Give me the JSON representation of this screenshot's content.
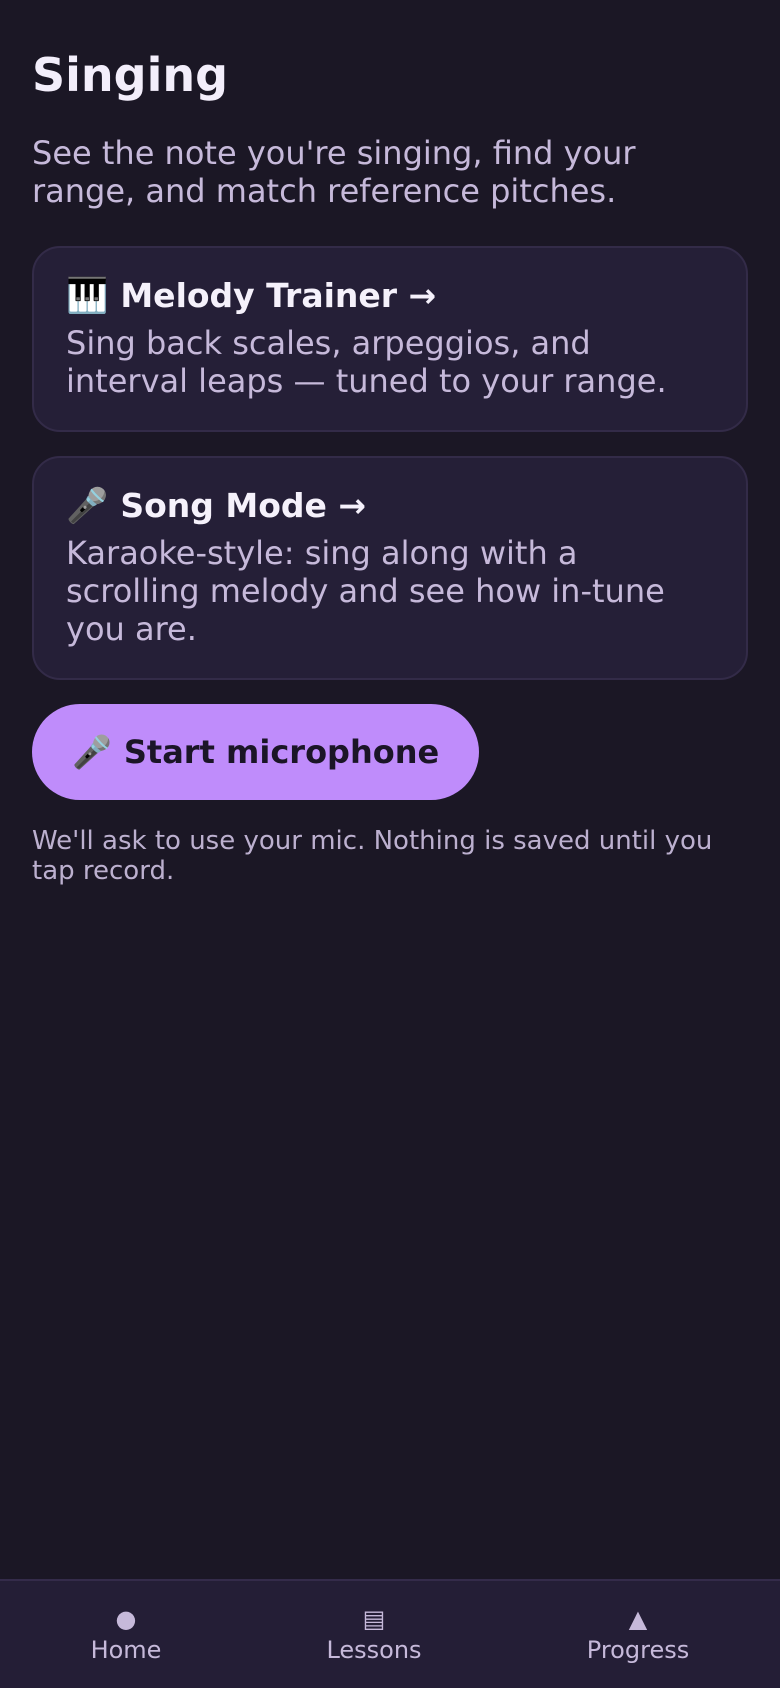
{
  "header": {
    "title": "Singing",
    "subtitle": "See the note you're singing, find your range, and match reference pitches."
  },
  "cards": [
    {
      "icon": "piano-keys-icon",
      "emoji": "🎹",
      "title": "Melody Trainer →",
      "description": "Sing back scales, arpeggios, and interval leaps — tuned to your range."
    },
    {
      "icon": "microphone-icon",
      "emoji": "🎤",
      "title": "Song Mode →",
      "description": "Karaoke-style: sing along with a scrolling melody and see how in-tune you are."
    }
  ],
  "mic": {
    "emoji": "🎤",
    "button_label": "Start microphone",
    "note": "We'll ask to use your mic. Nothing is saved until you tap record."
  },
  "nav": [
    {
      "icon": "circle-icon",
      "glyph": "●",
      "label": "Home"
    },
    {
      "icon": "list-icon",
      "glyph": "▤",
      "label": "Lessons"
    },
    {
      "icon": "triangle-icon",
      "glyph": "▲",
      "label": "Progress"
    }
  ],
  "colors": {
    "background": "#1b1725",
    "card": "#251f37",
    "accent": "#bf8cfb",
    "text_primary": "#f3eefb",
    "text_secondary": "#c6b9da"
  }
}
